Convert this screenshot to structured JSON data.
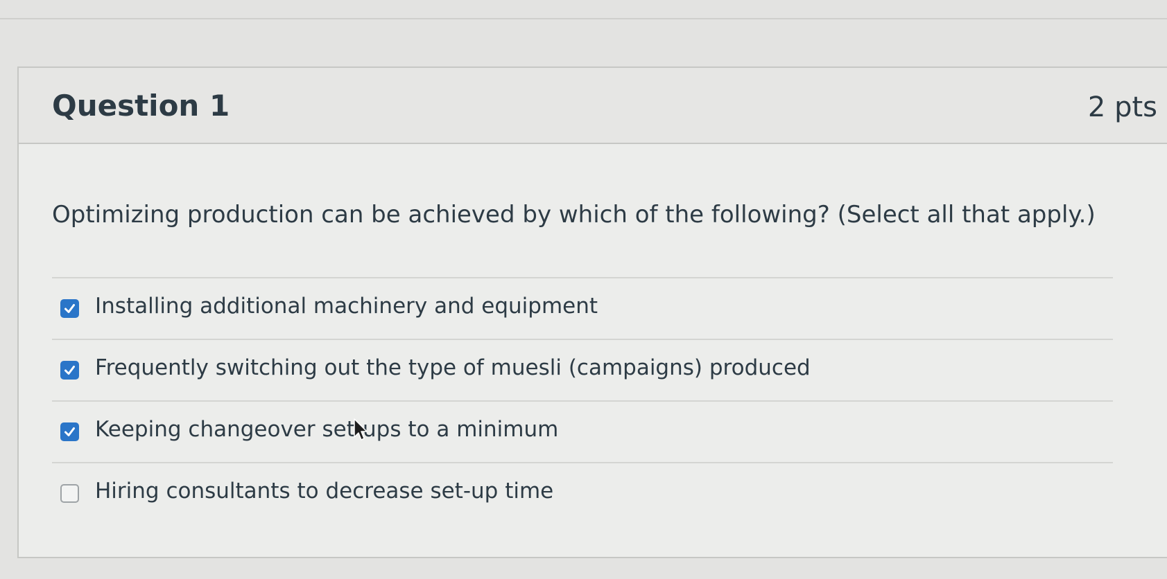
{
  "question": {
    "title": "Question 1",
    "points": "2 pts",
    "prompt": "Optimizing production can be achieved by which of the following? (Select all that apply.)"
  },
  "answers": [
    {
      "label": "Installing additional machinery and equipment",
      "checked": true
    },
    {
      "label": "Frequently switching out the type of muesli (campaigns) produced",
      "checked": true
    },
    {
      "label": "Keeping changeover set-ups to a minimum",
      "checked": true
    },
    {
      "label": "Hiring consultants to decrease set-up time",
      "checked": false
    }
  ],
  "colors": {
    "checkbox_checked": "#2a75c8",
    "text": "#2d3b45",
    "background": "#e3e3e1"
  },
  "icons": {
    "checked": "checkmark-icon",
    "cursor": "mouse-pointer-icon"
  }
}
